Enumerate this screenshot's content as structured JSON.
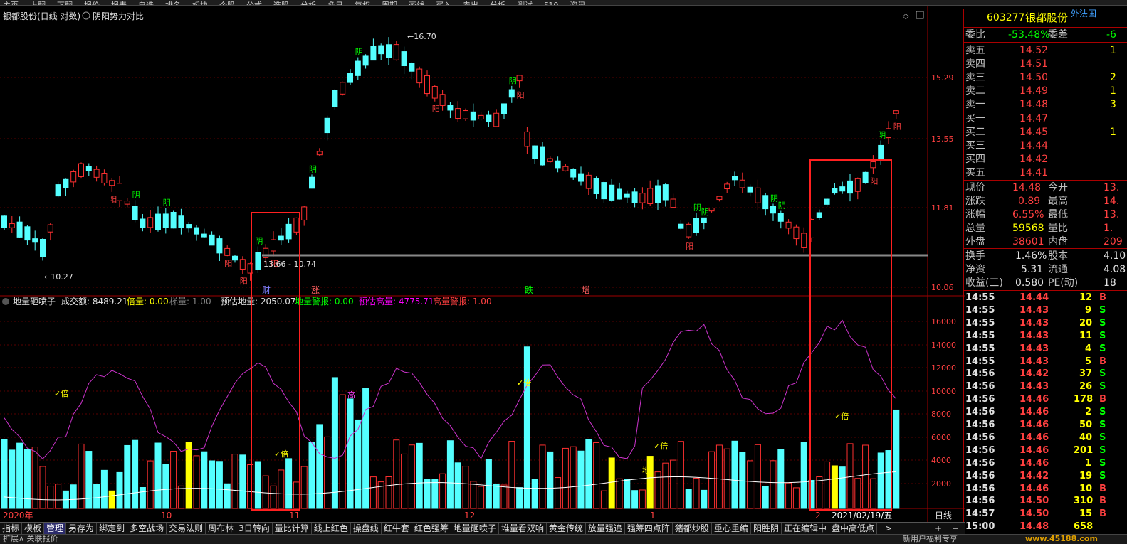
{
  "menu": [
    "主页",
    "上翻",
    "下翻",
    "报价",
    "报表",
    "自选",
    "排名",
    "板块",
    "个股",
    "公式",
    "选股",
    "分析",
    "多日",
    "复权",
    "周期",
    "画线",
    "买入",
    "卖出",
    "分析",
    "测试",
    "F10",
    "资讯"
  ],
  "chart": {
    "title": "银都股份(日线 对数)",
    "indicator": "阴阳势力对比",
    "price_ticks": [
      "15.29",
      "13.55",
      "11.81",
      "10.06"
    ],
    "vol_ticks": [
      "16000",
      "14000",
      "12000",
      "10000",
      "8000",
      "6000",
      "4000",
      "2000"
    ],
    "max_label": "16.70",
    "min_label": "10.27",
    "hline_label": "13.66 - 10.74",
    "marks": [
      {
        "t": "财",
        "c": "#8080ff"
      },
      {
        "t": "涨",
        "c": "#ff6060"
      },
      {
        "t": "跌",
        "c": "#00ff00"
      },
      {
        "t": "增",
        "c": "#ff6060"
      }
    ],
    "vol_header": [
      {
        "t": "地量砸喷子",
        "c": "#e0e0e0"
      },
      {
        "t": "成交额: 8489.21",
        "c": "#e0e0e0"
      },
      {
        "t": "倍量: 0.00",
        "c": "#ffff00"
      },
      {
        "t": "梯量: 1.00",
        "c": "#808080"
      },
      {
        "t": "预估地量: 2050.07",
        "c": "#e0e0e0"
      },
      {
        "t": "地量警报: 0.00",
        "c": "#00ff00"
      },
      {
        "t": "预估高量: 4775.71",
        "c": "#ff00ff"
      },
      {
        "t": "高量警报: 1.00",
        "c": "#ff4040"
      }
    ],
    "date_axis": [
      "2020年",
      "10",
      "11",
      "12",
      "1",
      "2",
      "2021/02/19/五",
      "日线"
    ],
    "yin": "阴",
    "yang": "阳",
    "gao": "高",
    "bei": "倍",
    "di": "地",
    "ditext": "地"
  },
  "quote": {
    "code": "603277",
    "name": "银都股份",
    "tag": "外法国",
    "weibi_label": "委比",
    "weibi": "-53.48%",
    "weicha_label": "委差",
    "weicha": "-6",
    "asks": [
      {
        "l": "卖五",
        "p": "14.52",
        "v": "1"
      },
      {
        "l": "卖四",
        "p": "14.51",
        "v": ""
      },
      {
        "l": "卖三",
        "p": "14.50",
        "v": "2"
      },
      {
        "l": "卖二",
        "p": "14.49",
        "v": "1"
      },
      {
        "l": "卖一",
        "p": "14.48",
        "v": "3"
      }
    ],
    "bids": [
      {
        "l": "买一",
        "p": "14.47",
        "v": ""
      },
      {
        "l": "买二",
        "p": "14.45",
        "v": "1"
      },
      {
        "l": "买三",
        "p": "14.44",
        "v": ""
      },
      {
        "l": "买四",
        "p": "14.42",
        "v": ""
      },
      {
        "l": "买五",
        "p": "14.41",
        "v": ""
      }
    ],
    "stats": [
      {
        "a": "现价",
        "av": "14.48",
        "ac": "#ff4040",
        "b": "今开",
        "bv": "13."
      },
      {
        "a": "涨跌",
        "av": "0.89",
        "ac": "#ff4040",
        "b": "最高",
        "bv": "14."
      },
      {
        "a": "涨幅",
        "av": "6.55%",
        "ac": "#ff4040",
        "b": "最低",
        "bv": "13."
      },
      {
        "a": "总量",
        "av": "59568",
        "ac": "#ffff00",
        "b": "量比",
        "bv": "1."
      },
      {
        "a": "外盘",
        "av": "38601",
        "ac": "#ff4040",
        "b": "内盘",
        "bv": "209"
      }
    ],
    "stats2": [
      {
        "a": "换手",
        "av": "1.46%",
        "b": "股本",
        "bv": "4.10"
      },
      {
        "a": "净资",
        "av": "5.31",
        "b": "流通",
        "bv": "4.08"
      },
      {
        "a": "收益(三)",
        "av": "0.580",
        "b": "PE(动)",
        "bv": "18"
      }
    ],
    "ticks": [
      {
        "t": "14:55",
        "p": "14.44",
        "v": "12",
        "s": "B"
      },
      {
        "t": "14:55",
        "p": "14.43",
        "v": "9",
        "s": "S"
      },
      {
        "t": "14:55",
        "p": "14.43",
        "v": "20",
        "s": "S"
      },
      {
        "t": "14:55",
        "p": "14.43",
        "v": "11",
        "s": "S"
      },
      {
        "t": "14:55",
        "p": "14.43",
        "v": "4",
        "s": "S"
      },
      {
        "t": "14:55",
        "p": "14.43",
        "v": "5",
        "s": "B"
      },
      {
        "t": "14:56",
        "p": "14.42",
        "v": "37",
        "s": "S"
      },
      {
        "t": "14:56",
        "p": "14.43",
        "v": "26",
        "s": "S"
      },
      {
        "t": "14:56",
        "p": "14.46",
        "v": "178",
        "s": "B"
      },
      {
        "t": "14:56",
        "p": "14.46",
        "v": "2",
        "s": "S"
      },
      {
        "t": "14:56",
        "p": "14.46",
        "v": "50",
        "s": "S"
      },
      {
        "t": "14:56",
        "p": "14.46",
        "v": "40",
        "s": "S"
      },
      {
        "t": "14:56",
        "p": "14.46",
        "v": "201",
        "s": "S"
      },
      {
        "t": "14:56",
        "p": "14.46",
        "v": "1",
        "s": "S"
      },
      {
        "t": "14:56",
        "p": "14.42",
        "v": "19",
        "s": "S"
      },
      {
        "t": "14:56",
        "p": "14.46",
        "v": "10",
        "s": "B"
      },
      {
        "t": "14:56",
        "p": "14.50",
        "v": "310",
        "s": "B"
      },
      {
        "t": "14:57",
        "p": "14.50",
        "v": "15",
        "s": "B"
      },
      {
        "t": "15:00",
        "p": "14.48",
        "v": "658",
        "s": ""
      }
    ]
  },
  "tabs": [
    "指标",
    "模板",
    "管理",
    "另存为",
    "绑定到",
    "多空战场",
    "交易法则",
    "周布林",
    "3日转向",
    "量比计算",
    "线上红色",
    "操盘线",
    "红牛套",
    "红色强筹",
    "地量砸喷子",
    "堆量看双响",
    "黄金传统",
    "放量强追",
    "强筹四点阵",
    "猪都炒股",
    "重心重编",
    "阳胜阴",
    "正在编辑中",
    "盘中高低点"
  ],
  "active_tab": "管理",
  "bottom": {
    "left": "扩展∧ 关联报价",
    "right": "新用户福利专享",
    "watermark": "www.45188.com"
  },
  "colors": {
    "up": "#ff3030",
    "down": "#54ffff",
    "frame": "#a00000",
    "yellow": "#ffff00",
    "magenta": "#cc33cc"
  }
}
